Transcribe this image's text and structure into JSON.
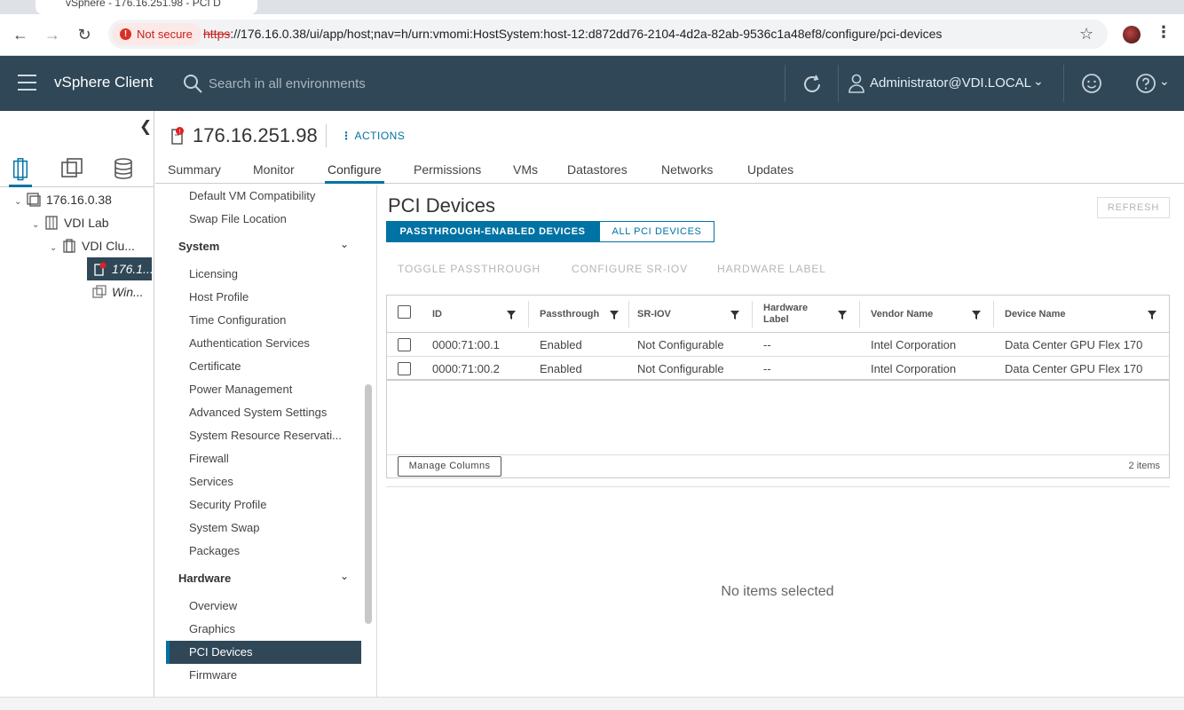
{
  "browser": {
    "tab_title": "vSphere - 176.16.251.98 - PCI D",
    "not_secure": "Not secure",
    "url_scheme": "https",
    "url_rest": "://176.16.0.38/ui/app/host;nav=h/urn:vmomi:HostSystem:host-12:d872dd76-2104-4d2a-82ab-9536c1a48ef8/configure/pci-devices"
  },
  "header": {
    "app_title": "vSphere Client",
    "search_placeholder": "Search in all environments",
    "user": "Administrator@VDI.LOCAL"
  },
  "tree": {
    "items": [
      {
        "label": "176.16.0.38"
      },
      {
        "label": "VDI Lab"
      },
      {
        "label": "VDI Clu..."
      },
      {
        "label": "176.1..."
      },
      {
        "label": "Win..."
      }
    ]
  },
  "host": {
    "name": "176.16.251.98",
    "actions_label": "ACTIONS"
  },
  "tabs": [
    "Summary",
    "Monitor",
    "Configure",
    "Permissions",
    "VMs",
    "Datastores",
    "Networks",
    "Updates"
  ],
  "config_nav": {
    "top_items": [
      "Default VM Compatibility",
      "Swap File Location"
    ],
    "system_header": "System",
    "system_items": [
      "Licensing",
      "Host Profile",
      "Time Configuration",
      "Authentication Services",
      "Certificate",
      "Power Management",
      "Advanced System Settings",
      "System Resource Reservati...",
      "Firewall",
      "Services",
      "Security Profile",
      "System Swap",
      "Packages"
    ],
    "hardware_header": "Hardware",
    "hardware_items": [
      "Overview",
      "Graphics",
      "PCI Devices",
      "Firmware"
    ]
  },
  "main": {
    "title": "PCI Devices",
    "refresh": "REFRESH",
    "seg_passthrough": "PASSTHROUGH-ENABLED DEVICES",
    "seg_all": "ALL PCI DEVICES",
    "toolbar": [
      "TOGGLE PASSTHROUGH",
      "CONFIGURE SR-IOV",
      "HARDWARE LABEL"
    ],
    "columns": [
      "ID",
      "Passthrough",
      "SR-IOV",
      "Hardware Label",
      "Vendor Name",
      "Device Name"
    ],
    "rows": [
      [
        "0000:71:00.1",
        "Enabled",
        "Not Configurable",
        "--",
        "Intel Corporation",
        "Data Center GPU Flex 170"
      ],
      [
        "0000:71:00.2",
        "Enabled",
        "Not Configurable",
        "--",
        "Intel Corporation",
        "Data Center GPU Flex 170"
      ]
    ],
    "manage_columns": "Manage Columns",
    "items_count": "2 items",
    "no_items": "No items selected"
  },
  "colors": {
    "header_bg": "#2f4757",
    "accent": "#0072a3"
  }
}
